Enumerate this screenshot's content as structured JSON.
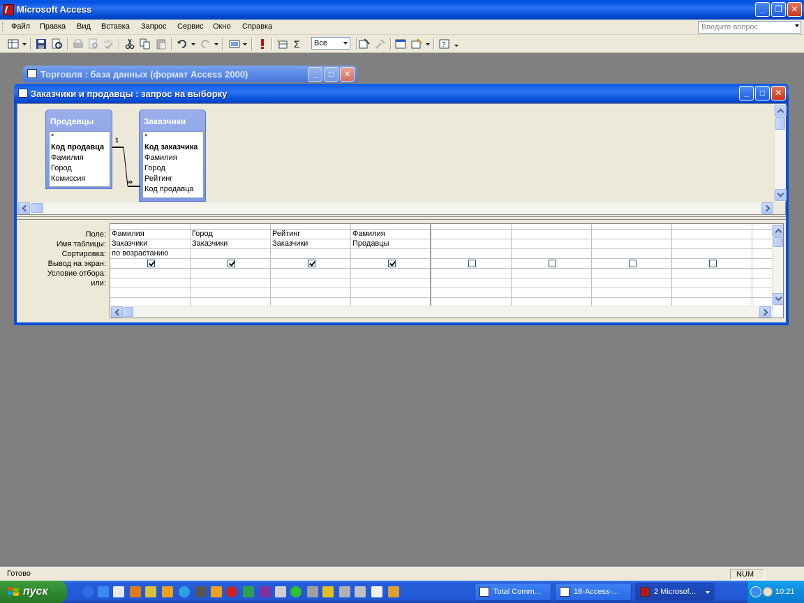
{
  "app": {
    "title": "Microsoft Access"
  },
  "menu": {
    "items": [
      "Файл",
      "Правка",
      "Вид",
      "Вставка",
      "Запрос",
      "Сервис",
      "Окно",
      "Справка"
    ],
    "help_placeholder": "Введите вопрос"
  },
  "toolbar": {
    "top_values": "Все"
  },
  "db_window": {
    "title": "Торговля : база данных (формат Access 2000)"
  },
  "query_window": {
    "title": "Заказчики и продавцы : запрос на выборку",
    "tables": [
      {
        "name": "Продавцы",
        "fields": [
          "*",
          "Код продавца",
          "Фамилия",
          "Город",
          "Комиссия"
        ],
        "key_index": 1
      },
      {
        "name": "Заказчики",
        "fields": [
          "*",
          "Код заказчика",
          "Фамилия",
          "Город",
          "Рейтинг",
          "Код продавца"
        ],
        "key_index": 1
      }
    ],
    "relation": {
      "one": "1",
      "many": "∞"
    },
    "grid": {
      "row_labels": [
        "Поле:",
        "Имя таблицы:",
        "Сортировка:",
        "Вывод на экран:",
        "Условие отбора:",
        "или:"
      ],
      "columns": [
        {
          "field": "Фамилия",
          "table": "Заказчики",
          "sort": "по возрастанию",
          "show": true
        },
        {
          "field": "Город",
          "table": "Заказчики",
          "sort": "",
          "show": true
        },
        {
          "field": "Рейтинг",
          "table": "Заказчики",
          "sort": "",
          "show": true
        },
        {
          "field": "Фамилия",
          "table": "Продавцы",
          "sort": "",
          "show": true
        },
        {
          "field": "",
          "table": "",
          "sort": "",
          "show": false
        },
        {
          "field": "",
          "table": "",
          "sort": "",
          "show": false
        },
        {
          "field": "",
          "table": "",
          "sort": "",
          "show": false
        },
        {
          "field": "",
          "table": "",
          "sort": "",
          "show": false
        }
      ]
    }
  },
  "status": {
    "text": "Готово",
    "num": "NUM"
  },
  "taskbar": {
    "start_label": "пуск",
    "tasks": [
      "Total Comm...",
      "18-Access-...",
      "2 Microsof..."
    ],
    "clock": "10:21"
  }
}
